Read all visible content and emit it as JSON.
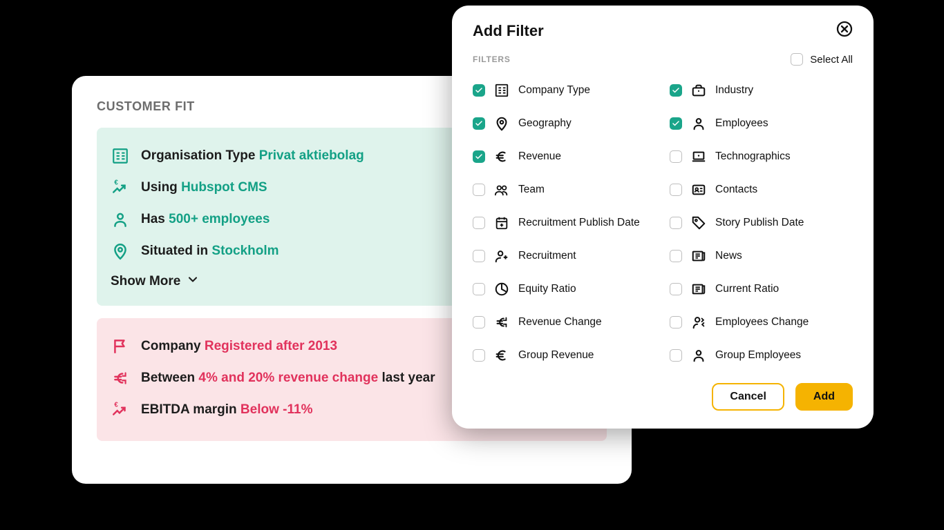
{
  "card": {
    "title": "CUSTOMER FIT",
    "good": {
      "rows": [
        {
          "prefix": "Organisation Type",
          "highlight": "Privat aktiebolag",
          "suffix": "",
          "icon": "building"
        },
        {
          "prefix": "Using",
          "highlight": "Hubspot CMS",
          "suffix": "",
          "icon": "trend-euro"
        },
        {
          "prefix": "Has",
          "highlight": "500+ employees",
          "suffix": "",
          "icon": "person"
        },
        {
          "prefix": "Situated in",
          "highlight": "Stockholm",
          "suffix": "",
          "icon": "pin"
        }
      ],
      "show_more": "Show More"
    },
    "bad": {
      "rows": [
        {
          "prefix": "Company",
          "highlight": "Registered after 2013",
          "suffix": "",
          "icon": "flag"
        },
        {
          "prefix": "Between",
          "highlight": "4% and 20% revenue change",
          "suffix": "last year",
          "icon": "euro-exchange"
        },
        {
          "prefix": "EBITDA margin",
          "highlight": "Below -11%",
          "suffix": "",
          "icon": "trend-euro"
        }
      ]
    }
  },
  "modal": {
    "title": "Add Filter",
    "filters_label": "FILTERS",
    "select_all": "Select All",
    "cancel": "Cancel",
    "add": "Add",
    "left": [
      {
        "label": "Company Type",
        "checked": true,
        "icon": "building"
      },
      {
        "label": "Geography",
        "checked": true,
        "icon": "pin"
      },
      {
        "label": "Revenue",
        "checked": true,
        "icon": "euro"
      },
      {
        "label": "Team",
        "checked": false,
        "icon": "team"
      },
      {
        "label": "Recruitment Publish Date",
        "checked": false,
        "icon": "calendar-plus"
      },
      {
        "label": "Recruitment",
        "checked": false,
        "icon": "person-plus"
      },
      {
        "label": "Equity Ratio",
        "checked": false,
        "icon": "pie"
      },
      {
        "label": "Revenue Change",
        "checked": false,
        "icon": "euro-exchange"
      },
      {
        "label": "Group Revenue",
        "checked": false,
        "icon": "euro"
      }
    ],
    "right": [
      {
        "label": "Industry",
        "checked": true,
        "icon": "briefcase"
      },
      {
        "label": "Employees",
        "checked": true,
        "icon": "person"
      },
      {
        "label": "Technographics",
        "checked": false,
        "icon": "laptop"
      },
      {
        "label": "Contacts",
        "checked": false,
        "icon": "id-card"
      },
      {
        "label": "Story Publish Date",
        "checked": false,
        "icon": "tag"
      },
      {
        "label": "News",
        "checked": false,
        "icon": "news"
      },
      {
        "label": "Current Ratio",
        "checked": false,
        "icon": "news"
      },
      {
        "label": "Employees Change",
        "checked": false,
        "icon": "person-swap"
      },
      {
        "label": "Group Employees",
        "checked": false,
        "icon": "person"
      }
    ]
  }
}
